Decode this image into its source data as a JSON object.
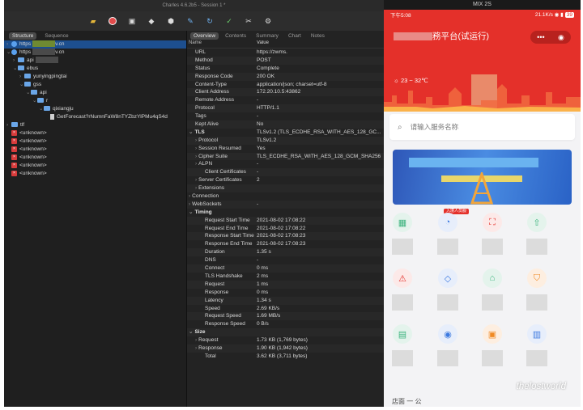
{
  "charles": {
    "title": "Charles 4.6.2b5 - Session 1 *",
    "left_tabs": [
      "Structure",
      "Sequence"
    ],
    "right_tabs": [
      "Overview",
      "Contents",
      "Summary",
      "Chart",
      "Notes"
    ],
    "toolbar_icons": [
      "broom-icon",
      "record-icon",
      "lock-icon",
      "turtle-icon",
      "breakpoint-icon",
      "pen-icon",
      "refresh-icon",
      "check-icon",
      "tools-icon",
      "settings-icon"
    ],
    "tree": [
      {
        "label": "https",
        "suffix": "v.cn",
        "kind": "globe",
        "indent": 0,
        "twisty": "›",
        "blur": "yellow",
        "selected": true
      },
      {
        "label": "https",
        "suffix": "v.cn",
        "kind": "globe",
        "indent": 0,
        "twisty": "⌄",
        "blur": "gray",
        "selected": false
      },
      {
        "label": "api",
        "kind": "folder",
        "indent": 1,
        "twisty": "›",
        "blur": "gray"
      },
      {
        "label": "ebus",
        "kind": "folder",
        "indent": 1,
        "twisty": "⌄"
      },
      {
        "label": "yunyingpingtai",
        "kind": "folder",
        "indent": 2,
        "twisty": "›"
      },
      {
        "label": "gss",
        "kind": "folder",
        "indent": 2,
        "twisty": "⌄"
      },
      {
        "label": "api",
        "kind": "folder",
        "indent": 3,
        "twisty": "⌄"
      },
      {
        "label": "r",
        "kind": "folder",
        "indent": 4,
        "twisty": "⌄"
      },
      {
        "label": "qixiangju",
        "kind": "folder",
        "indent": 5,
        "twisty": "⌄"
      },
      {
        "label": "GetForecast?rNumnFaW8nTYZbzYlPMu4qS4d",
        "kind": "doc",
        "indent": 6,
        "twisty": ""
      },
      {
        "label": "tlf",
        "kind": "folder",
        "indent": 0,
        "twisty": "›"
      },
      {
        "label": "<unknown>",
        "kind": "x",
        "indent": 0,
        "twisty": ""
      },
      {
        "label": "<unknown>",
        "kind": "x",
        "indent": 0,
        "twisty": ""
      },
      {
        "label": "<unknown>",
        "kind": "x",
        "indent": 0,
        "twisty": ""
      },
      {
        "label": "<unknown>",
        "kind": "x",
        "indent": 0,
        "twisty": ""
      },
      {
        "label": "<unknown>",
        "kind": "x",
        "indent": 0,
        "twisty": ""
      },
      {
        "label": "<unknown>",
        "kind": "x",
        "indent": 0,
        "twisty": ""
      }
    ],
    "col_headers": {
      "name": "Name",
      "value": "Value"
    },
    "overview": [
      {
        "name": "URL",
        "value": "https://zwms.",
        "level": 0
      },
      {
        "name": "Method",
        "value": "POST",
        "level": 0
      },
      {
        "name": "Status",
        "value": "Complete",
        "level": 0
      },
      {
        "name": "Response Code",
        "value": "200 OK",
        "level": 0
      },
      {
        "name": "Content-Type",
        "value": "application/json; charset=utf-8",
        "level": 0
      },
      {
        "name": "Client Address",
        "value": "172.20.10.5:43862",
        "level": 0
      },
      {
        "name": "Remote Address",
        "value": "-",
        "level": 0
      },
      {
        "name": "Protocol",
        "value": "HTTP/1.1",
        "level": 0
      },
      {
        "name": "Tags",
        "value": "-",
        "level": 0
      },
      {
        "name": "Kept Alive",
        "value": "No",
        "level": 0
      },
      {
        "name": "TLS",
        "value": "TLSv1.2 (TLS_ECDHE_RSA_WITH_AES_128_GC...",
        "level": "s",
        "twisty": "⌄"
      },
      {
        "name": "Protocol",
        "value": "TLSv1.2",
        "level": 1,
        "twisty": "›"
      },
      {
        "name": "Session Resumed",
        "value": "Yes",
        "level": 1,
        "twisty": "›"
      },
      {
        "name": "Cipher Suite",
        "value": "TLS_ECDHE_RSA_WITH_AES_128_GCM_SHA256",
        "level": 1,
        "twisty": "›"
      },
      {
        "name": "ALPN",
        "value": "-",
        "level": 1,
        "twisty": "›"
      },
      {
        "name": "Client Certificates",
        "value": "-",
        "level": 2
      },
      {
        "name": "Server Certificates",
        "value": "2",
        "level": 1,
        "twisty": "›"
      },
      {
        "name": "Extensions",
        "value": "",
        "level": 1,
        "twisty": "›"
      },
      {
        "name": "Connection",
        "value": "",
        "level": 0,
        "twisty": "›"
      },
      {
        "name": "WebSockets",
        "value": "-",
        "level": 0,
        "twisty": "›"
      },
      {
        "name": "Timing",
        "value": "",
        "level": "s",
        "twisty": "⌄"
      },
      {
        "name": "Request Start Time",
        "value": "2021-08-02 17:08:22",
        "level": 2
      },
      {
        "name": "Request End Time",
        "value": "2021-08-02 17:08:22",
        "level": 2
      },
      {
        "name": "Response Start Time",
        "value": "2021-08-02 17:08:23",
        "level": 2
      },
      {
        "name": "Response End Time",
        "value": "2021-08-02 17:08:23",
        "level": 2
      },
      {
        "name": "Duration",
        "value": "1.35 s",
        "level": 2
      },
      {
        "name": "DNS",
        "value": "-",
        "level": 2
      },
      {
        "name": "Connect",
        "value": "0 ms",
        "level": 2
      },
      {
        "name": "TLS Handshake",
        "value": "2 ms",
        "level": 2
      },
      {
        "name": "Request",
        "value": "1 ms",
        "level": 2
      },
      {
        "name": "Response",
        "value": "0 ms",
        "level": 2
      },
      {
        "name": "Latency",
        "value": "1.34 s",
        "level": 2
      },
      {
        "name": "Speed",
        "value": "2.69 KB/s",
        "level": 2
      },
      {
        "name": "Request Speed",
        "value": "1.69 MB/s",
        "level": 2
      },
      {
        "name": "Response Speed",
        "value": "0 B/s",
        "level": 2
      },
      {
        "name": "Size",
        "value": "",
        "level": "s",
        "twisty": "⌄"
      },
      {
        "name": "Request",
        "value": "1.73 KB (1,769 bytes)",
        "level": 1,
        "twisty": "›"
      },
      {
        "name": "Response",
        "value": "1.90 KB (1,942 bytes)",
        "level": 1,
        "twisty": "›"
      },
      {
        "name": "Total",
        "value": "3.62 KB (3,711 bytes)",
        "level": 2
      }
    ]
  },
  "phone": {
    "window_title": "MIX 2S",
    "status_time": "下午5:08",
    "status_right": "21.1K/s",
    "battery": "39",
    "page_title": "務平台(试运行)",
    "capsule_more": "•••",
    "weather": "23 ~ 32℃",
    "search_placeholder": "请输入服务名称",
    "new_badge": "入境人员服",
    "watermark": "thelostworld",
    "bottom_text": "店面 一 公",
    "colors": {
      "accent": "#e4302a",
      "green": "#3bb37d",
      "blue": "#3d7ae0",
      "orange": "#f08a24"
    }
  }
}
